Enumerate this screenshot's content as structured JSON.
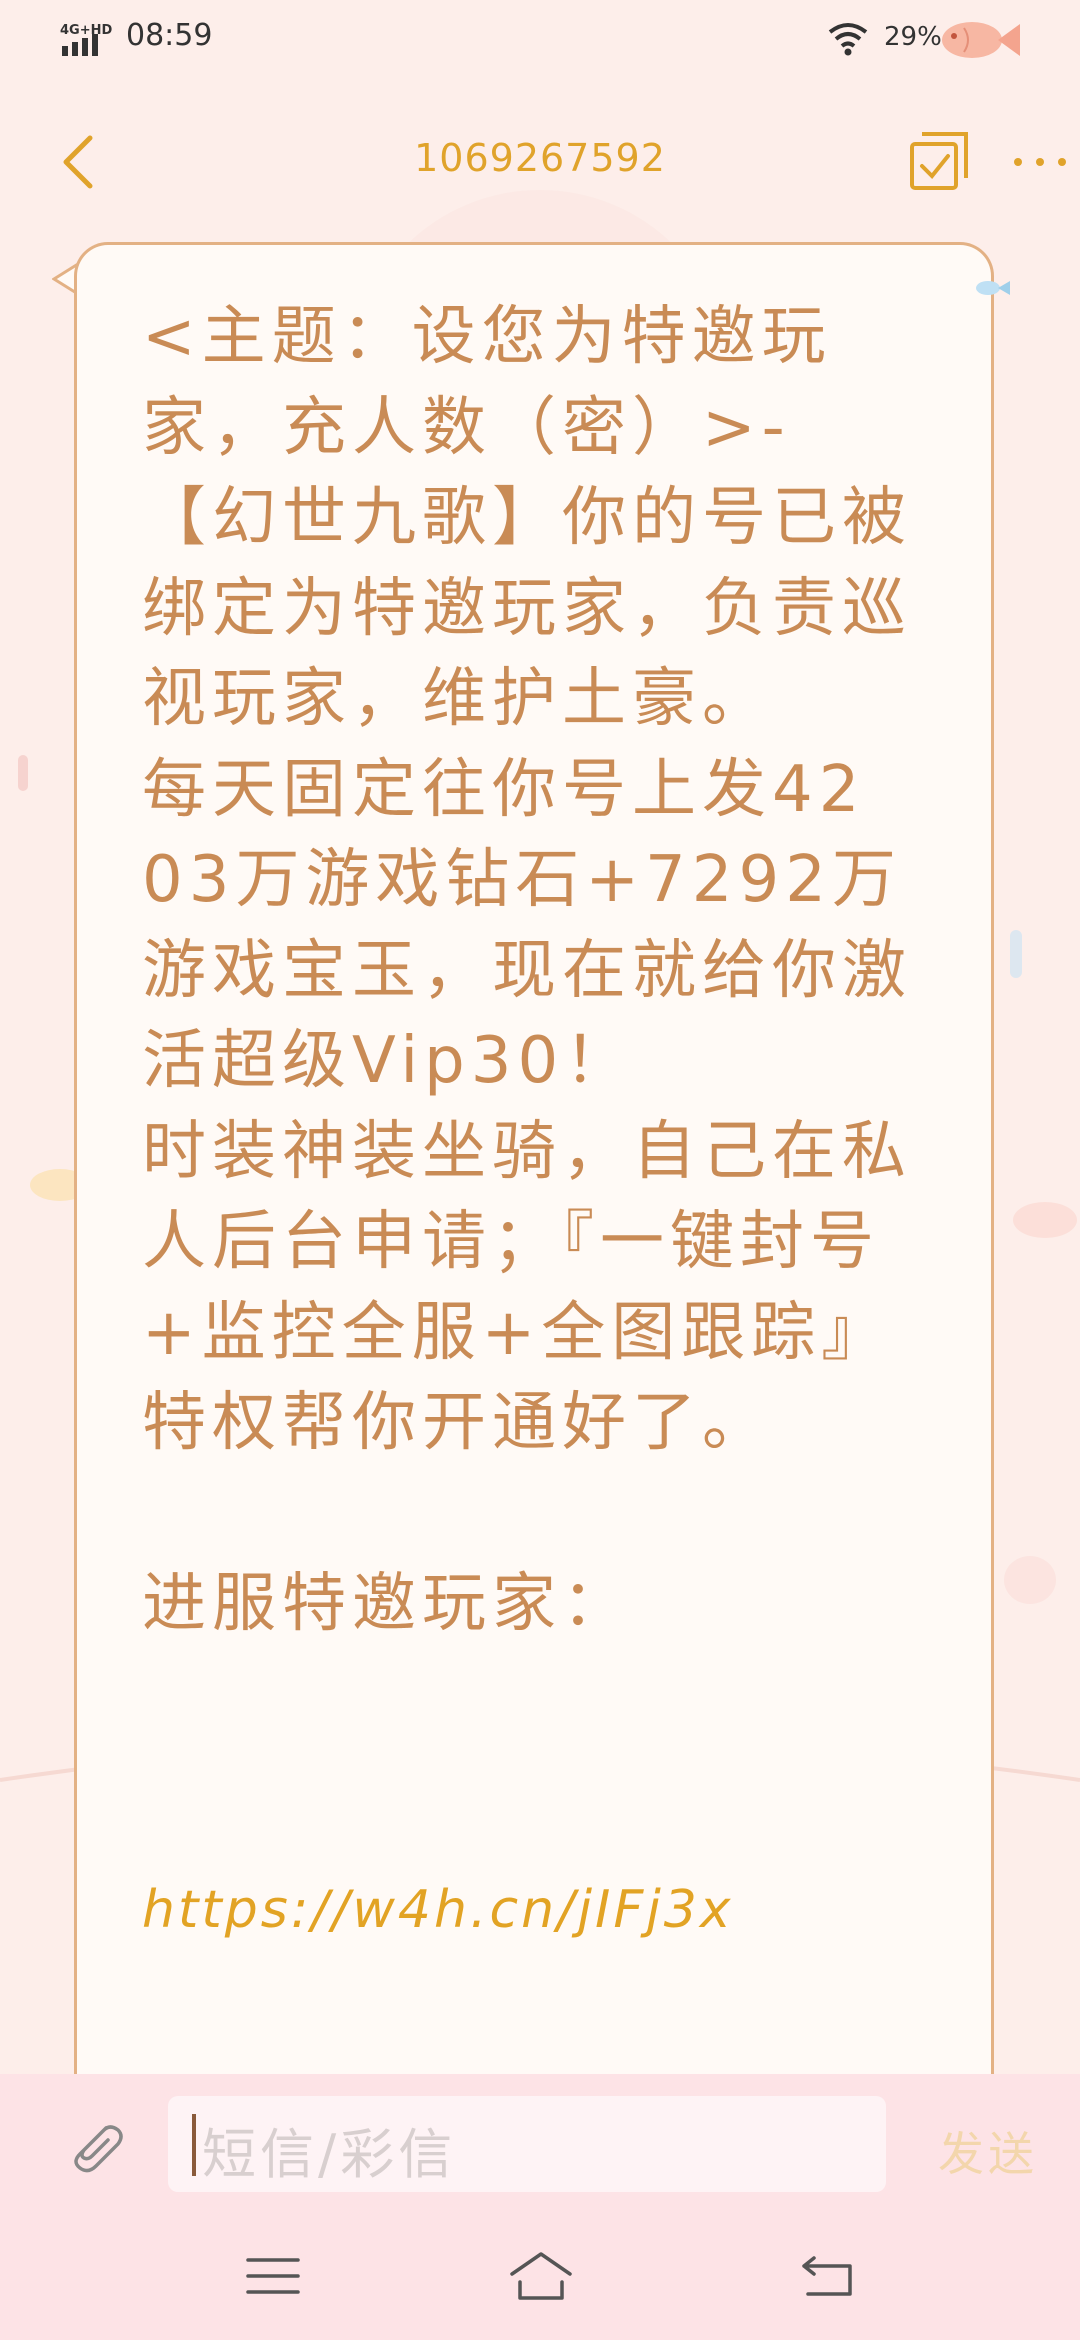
{
  "status_bar": {
    "network": "4G+HD",
    "time": "08:59",
    "battery": "29%"
  },
  "header": {
    "title": "1069267592",
    "icons": [
      "back-icon",
      "multi-select-icon",
      "more-icon"
    ]
  },
  "message": {
    "body": "<主题：设您为特邀玩家，充人数（密）>-【幻世九歌】你的号已被绑定为特邀玩家，负责巡视玩家，维护土豪。\n每天固定往你号上发4203万游戏钻石+7292万游戏宝玉，现在就给你激活超级Vip30！\n时装神装坐骑，自己在私人后台申请；『一键封号+监控全服+全图跟踪』特权帮你开通好了。\n\n进服特邀玩家：",
    "link": "https://w4h.cn/jIFj3x"
  },
  "compose": {
    "placeholder": "短信/彩信",
    "send_label": "发送"
  },
  "nav_bar": {
    "icons": [
      "menu-icon",
      "home-icon",
      "back-nav-icon"
    ]
  },
  "colors": {
    "background": "#fdeeea",
    "accent": "#e0a32b",
    "message_text": "#c98b55",
    "bubble_border": "#e3b184",
    "compose_bg": "#fde3e6"
  }
}
